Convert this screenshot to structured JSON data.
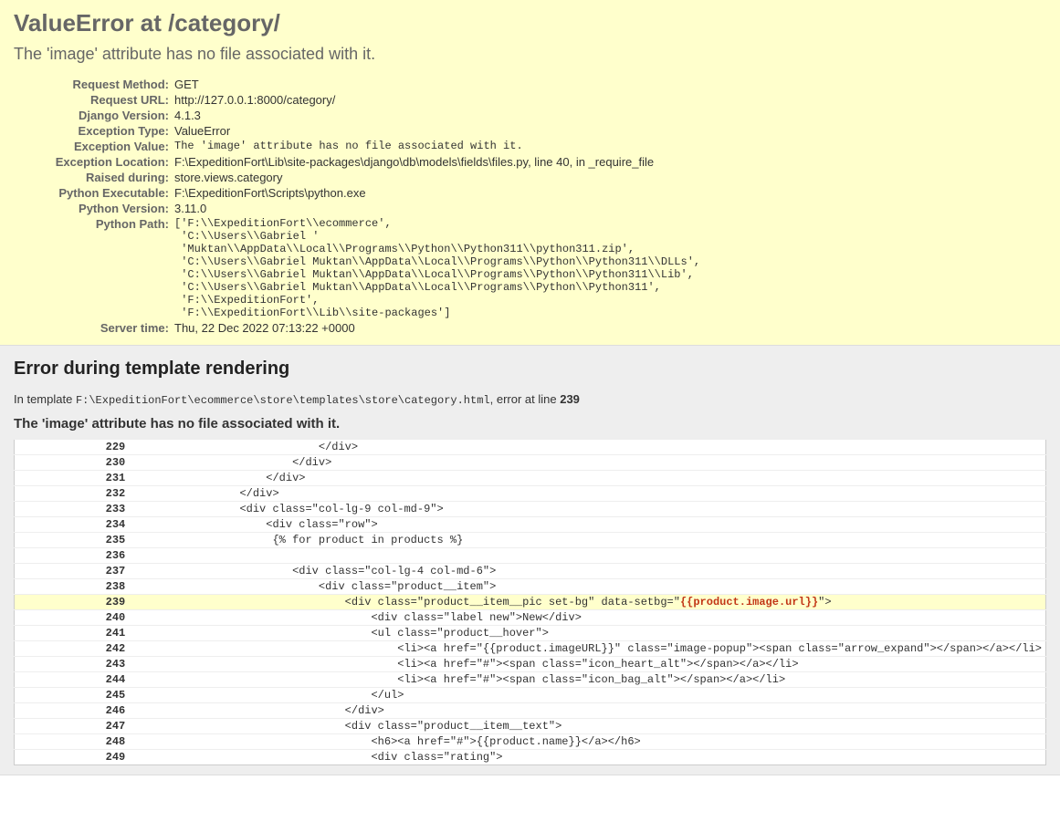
{
  "summary": {
    "title": "ValueError at /category/",
    "subtitle": "The 'image' attribute has no file associated with it.",
    "rows": [
      {
        "label": "Request Method:",
        "value": "GET",
        "mono": false
      },
      {
        "label": "Request URL:",
        "value": "http://127.0.0.1:8000/category/",
        "mono": false
      },
      {
        "label": "Django Version:",
        "value": "4.1.3",
        "mono": false
      },
      {
        "label": "Exception Type:",
        "value": "ValueError",
        "mono": false
      },
      {
        "label": "Exception Value:",
        "value": "The 'image' attribute has no file associated with it.",
        "mono": true
      },
      {
        "label": "Exception Location:",
        "value": "F:\\ExpeditionFort\\Lib\\site-packages\\django\\db\\models\\fields\\files.py, line 40, in _require_file",
        "mono": false
      },
      {
        "label": "Raised during:",
        "value": "store.views.category",
        "mono": false
      },
      {
        "label": "Python Executable:",
        "value": "F:\\ExpeditionFort\\Scripts\\python.exe",
        "mono": false
      },
      {
        "label": "Python Version:",
        "value": "3.11.0",
        "mono": false
      },
      {
        "label": "Python Path:",
        "value": "['F:\\\\ExpeditionFort\\\\ecommerce',\n 'C:\\\\Users\\\\Gabriel '\n 'Muktan\\\\AppData\\\\Local\\\\Programs\\\\Python\\\\Python311\\\\python311.zip',\n 'C:\\\\Users\\\\Gabriel Muktan\\\\AppData\\\\Local\\\\Programs\\\\Python\\\\Python311\\\\DLLs',\n 'C:\\\\Users\\\\Gabriel Muktan\\\\AppData\\\\Local\\\\Programs\\\\Python\\\\Python311\\\\Lib',\n 'C:\\\\Users\\\\Gabriel Muktan\\\\AppData\\\\Local\\\\Programs\\\\Python\\\\Python311',\n 'F:\\\\ExpeditionFort',\n 'F:\\\\ExpeditionFort\\\\Lib\\\\site-packages']",
        "mono": true
      },
      {
        "label": "Server time:",
        "value": "Thu, 22 Dec 2022 07:13:22 +0000",
        "mono": false
      }
    ]
  },
  "template": {
    "heading": "Error during template rendering",
    "intro_prefix": "In template ",
    "intro_path": "F:\\ExpeditionFort\\ecommerce\\store\\templates\\store\\category.html",
    "intro_middle": ", error at line ",
    "intro_line": "239",
    "subheading": "The 'image' attribute has no file associated with it.",
    "error_line": 239,
    "lines": [
      {
        "num": 229,
        "text": "                            </div>"
      },
      {
        "num": 230,
        "text": "                        </div>"
      },
      {
        "num": 231,
        "text": "                    </div>"
      },
      {
        "num": 232,
        "text": "                </div>"
      },
      {
        "num": 233,
        "text": "                <div class=\"col-lg-9 col-md-9\">"
      },
      {
        "num": 234,
        "text": "                    <div class=\"row\">"
      },
      {
        "num": 235,
        "text": "                     {% for product in products %}"
      },
      {
        "num": 236,
        "text": ""
      },
      {
        "num": 237,
        "text": "                        <div class=\"col-lg-4 col-md-6\">"
      },
      {
        "num": 238,
        "text": "                            <div class=\"product__item\">"
      },
      {
        "num": 239,
        "is_error": true,
        "pre": "                                <div class=\"product__item__pic set-bg\" data-setbg=\"",
        "hl": "{{product.image.url}}",
        "post": "\">"
      },
      {
        "num": 240,
        "text": "                                    <div class=\"label new\">New</div>"
      },
      {
        "num": 241,
        "text": "                                    <ul class=\"product__hover\">"
      },
      {
        "num": 242,
        "text": "                                        <li><a href=\"{{product.imageURL}}\" class=\"image-popup\"><span class=\"arrow_expand\"></span></a></li>"
      },
      {
        "num": 243,
        "text": "                                        <li><a href=\"#\"><span class=\"icon_heart_alt\"></span></a></li>"
      },
      {
        "num": 244,
        "text": "                                        <li><a href=\"#\"><span class=\"icon_bag_alt\"></span></a></li>"
      },
      {
        "num": 245,
        "text": "                                    </ul>"
      },
      {
        "num": 246,
        "text": "                                </div>"
      },
      {
        "num": 247,
        "text": "                                <div class=\"product__item__text\">"
      },
      {
        "num": 248,
        "text": "                                    <h6><a href=\"#\">{{product.name}}</a></h6>"
      },
      {
        "num": 249,
        "text": "                                    <div class=\"rating\">"
      }
    ]
  }
}
